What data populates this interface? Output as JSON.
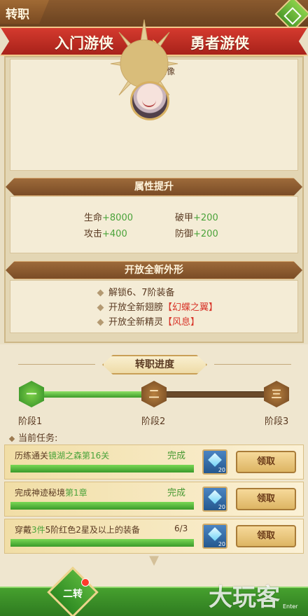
{
  "header": {
    "title": "转职"
  },
  "class_change": {
    "from": "入门游侠",
    "arrows": "›››",
    "to": "勇者游侠"
  },
  "avatar_section": {
    "label": "解锁新头像"
  },
  "attributes": {
    "title": "属性提升",
    "items": [
      {
        "name": "生命",
        "value": "+8000"
      },
      {
        "name": "破甲",
        "value": "+200"
      },
      {
        "name": "攻击",
        "value": "+400"
      },
      {
        "name": "防御",
        "value": "+200"
      }
    ]
  },
  "appearance": {
    "title": "开放全新外形",
    "items": [
      {
        "text": "解锁6、7阶装备",
        "highlight": ""
      },
      {
        "text": "开放全新翅膀",
        "highlight": "【幻蝶之翼】"
      },
      {
        "text": "开放全新精灵",
        "highlight": "【风息】"
      }
    ]
  },
  "progress": {
    "title": "转职进度",
    "stages": [
      {
        "glyph": "一",
        "label": "阶段1",
        "done": true
      },
      {
        "glyph": "二",
        "label": "阶段2",
        "done": false
      },
      {
        "glyph": "三",
        "label": "阶段3",
        "done": false
      }
    ],
    "fill_ratio": 0.5
  },
  "tasks": {
    "header": "当前任务:",
    "items": [
      {
        "prefix": "历练通关",
        "green": "镜湖之森第16关",
        "suffix": "",
        "status": "完成",
        "progress": 1.0,
        "reward_qty": "20",
        "button": "领取"
      },
      {
        "prefix": "完成神迹秘境",
        "green": "第1章",
        "suffix": "",
        "status": "完成",
        "progress": 1.0,
        "reward_qty": "20",
        "button": "领取"
      },
      {
        "prefix": "穿戴",
        "green": "3件",
        "suffix": "5阶红色2星及以上的装备",
        "status": "6/3",
        "progress": 1.0,
        "reward_qty": "20",
        "button": "领取"
      }
    ]
  },
  "bottom": {
    "tier_label": "二转"
  },
  "watermark": {
    "text": "大玩客",
    "sub": "Enter"
  }
}
